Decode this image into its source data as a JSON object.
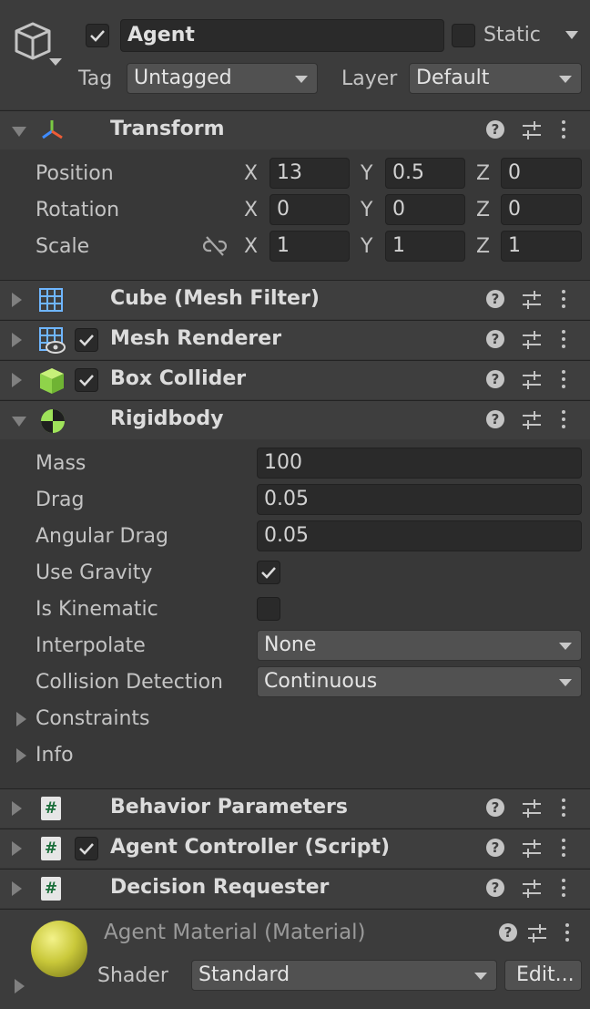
{
  "gameobject": {
    "icon": "cube-outline-icon",
    "active": true,
    "name": "Agent",
    "static_label": "Static",
    "static_checked": false,
    "tag_label": "Tag",
    "tag_value": "Untagged",
    "layer_label": "Layer",
    "layer_value": "Default"
  },
  "transform": {
    "title": "Transform",
    "icon": "transform-axes-icon",
    "position_label": "Position",
    "rotation_label": "Rotation",
    "scale_label": "Scale",
    "axis_x": "X",
    "axis_y": "Y",
    "axis_z": "Z",
    "position": {
      "x": "13",
      "y": "0.5",
      "z": "0"
    },
    "rotation": {
      "x": "0",
      "y": "0",
      "z": "0"
    },
    "scale": {
      "x": "1",
      "y": "1",
      "z": "1"
    }
  },
  "components": {
    "mesh_filter": {
      "title": "Cube (Mesh Filter)",
      "icon": "mesh-grid-icon"
    },
    "mesh_renderer": {
      "title": "Mesh Renderer",
      "icon": "mesh-renderer-icon",
      "enabled": true
    },
    "box_collider": {
      "title": "Box Collider",
      "icon": "green-cube-icon",
      "enabled": true
    },
    "behavior_parameters": {
      "title": "Behavior Parameters",
      "icon": "script-hash-icon"
    },
    "agent_controller": {
      "title": "Agent Controller (Script)",
      "icon": "script-hash-icon",
      "enabled": true
    },
    "decision_requester": {
      "title": "Decision Requester",
      "icon": "script-hash-icon"
    }
  },
  "rigidbody": {
    "title": "Rigidbody",
    "icon": "rigidbody-icon",
    "mass_label": "Mass",
    "mass": "100",
    "drag_label": "Drag",
    "drag": "0.05",
    "angular_drag_label": "Angular Drag",
    "angular_drag": "0.05",
    "use_gravity_label": "Use Gravity",
    "use_gravity": true,
    "is_kinematic_label": "Is Kinematic",
    "is_kinematic": false,
    "interpolate_label": "Interpolate",
    "interpolate": "None",
    "collision_label": "Collision Detection",
    "collision": "Continuous",
    "constraints_label": "Constraints",
    "info_label": "Info"
  },
  "material": {
    "name": "Agent Material (Material)",
    "shader_label": "Shader",
    "shader_value": "Standard",
    "edit_label": "Edit..."
  },
  "colors": {
    "background": "#383838",
    "header": "#3e3e3e",
    "field": "#2a2a2a",
    "material_sphere": "#c9c83a"
  }
}
